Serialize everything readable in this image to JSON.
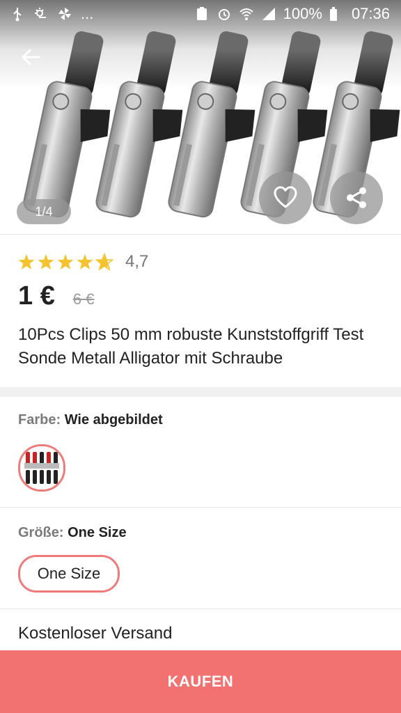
{
  "status_bar": {
    "battery": "100%",
    "time": "07:36",
    "more": "..."
  },
  "gallery": {
    "counter": "1/4"
  },
  "product": {
    "rating_value": "4,7",
    "rating": 4.7,
    "price": "1 €",
    "old_price": "6 €",
    "title": "10Pcs Clips 50 mm robuste Kunststoffgriff Test Sonde Metall Alligator mit Schraube"
  },
  "options": {
    "color_label": "Farbe:",
    "color_value": "Wie abgebildet",
    "size_label": "Größe:",
    "size_value": "One Size",
    "size_chip": "One Size"
  },
  "shipping": {
    "text": "Kostenloser Versand"
  },
  "actions": {
    "buy_label": "KAUFEN"
  },
  "colors": {
    "accent": "#f27272",
    "star": "#f4c430"
  },
  "icons": [
    "back-arrow-icon",
    "heart-icon",
    "share-icon",
    "star-icon"
  ]
}
